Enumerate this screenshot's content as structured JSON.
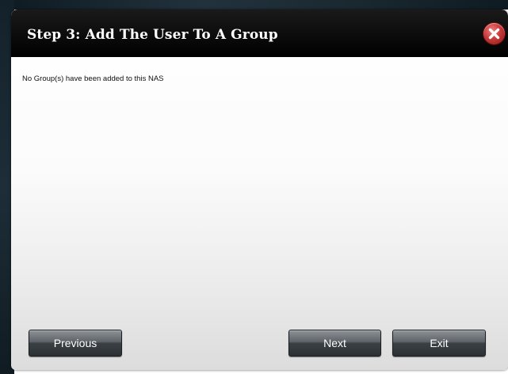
{
  "dialog": {
    "title": "Step 3: Add The User To A Group",
    "message": "No Group(s) have been added to this NAS",
    "buttons": {
      "previous": "Previous",
      "next": "Next",
      "exit": "Exit"
    }
  },
  "icons": {
    "close": "close-icon"
  },
  "colors": {
    "titlebar": "#000000",
    "close_button": "#c83a3a",
    "button": "#4a5055"
  }
}
